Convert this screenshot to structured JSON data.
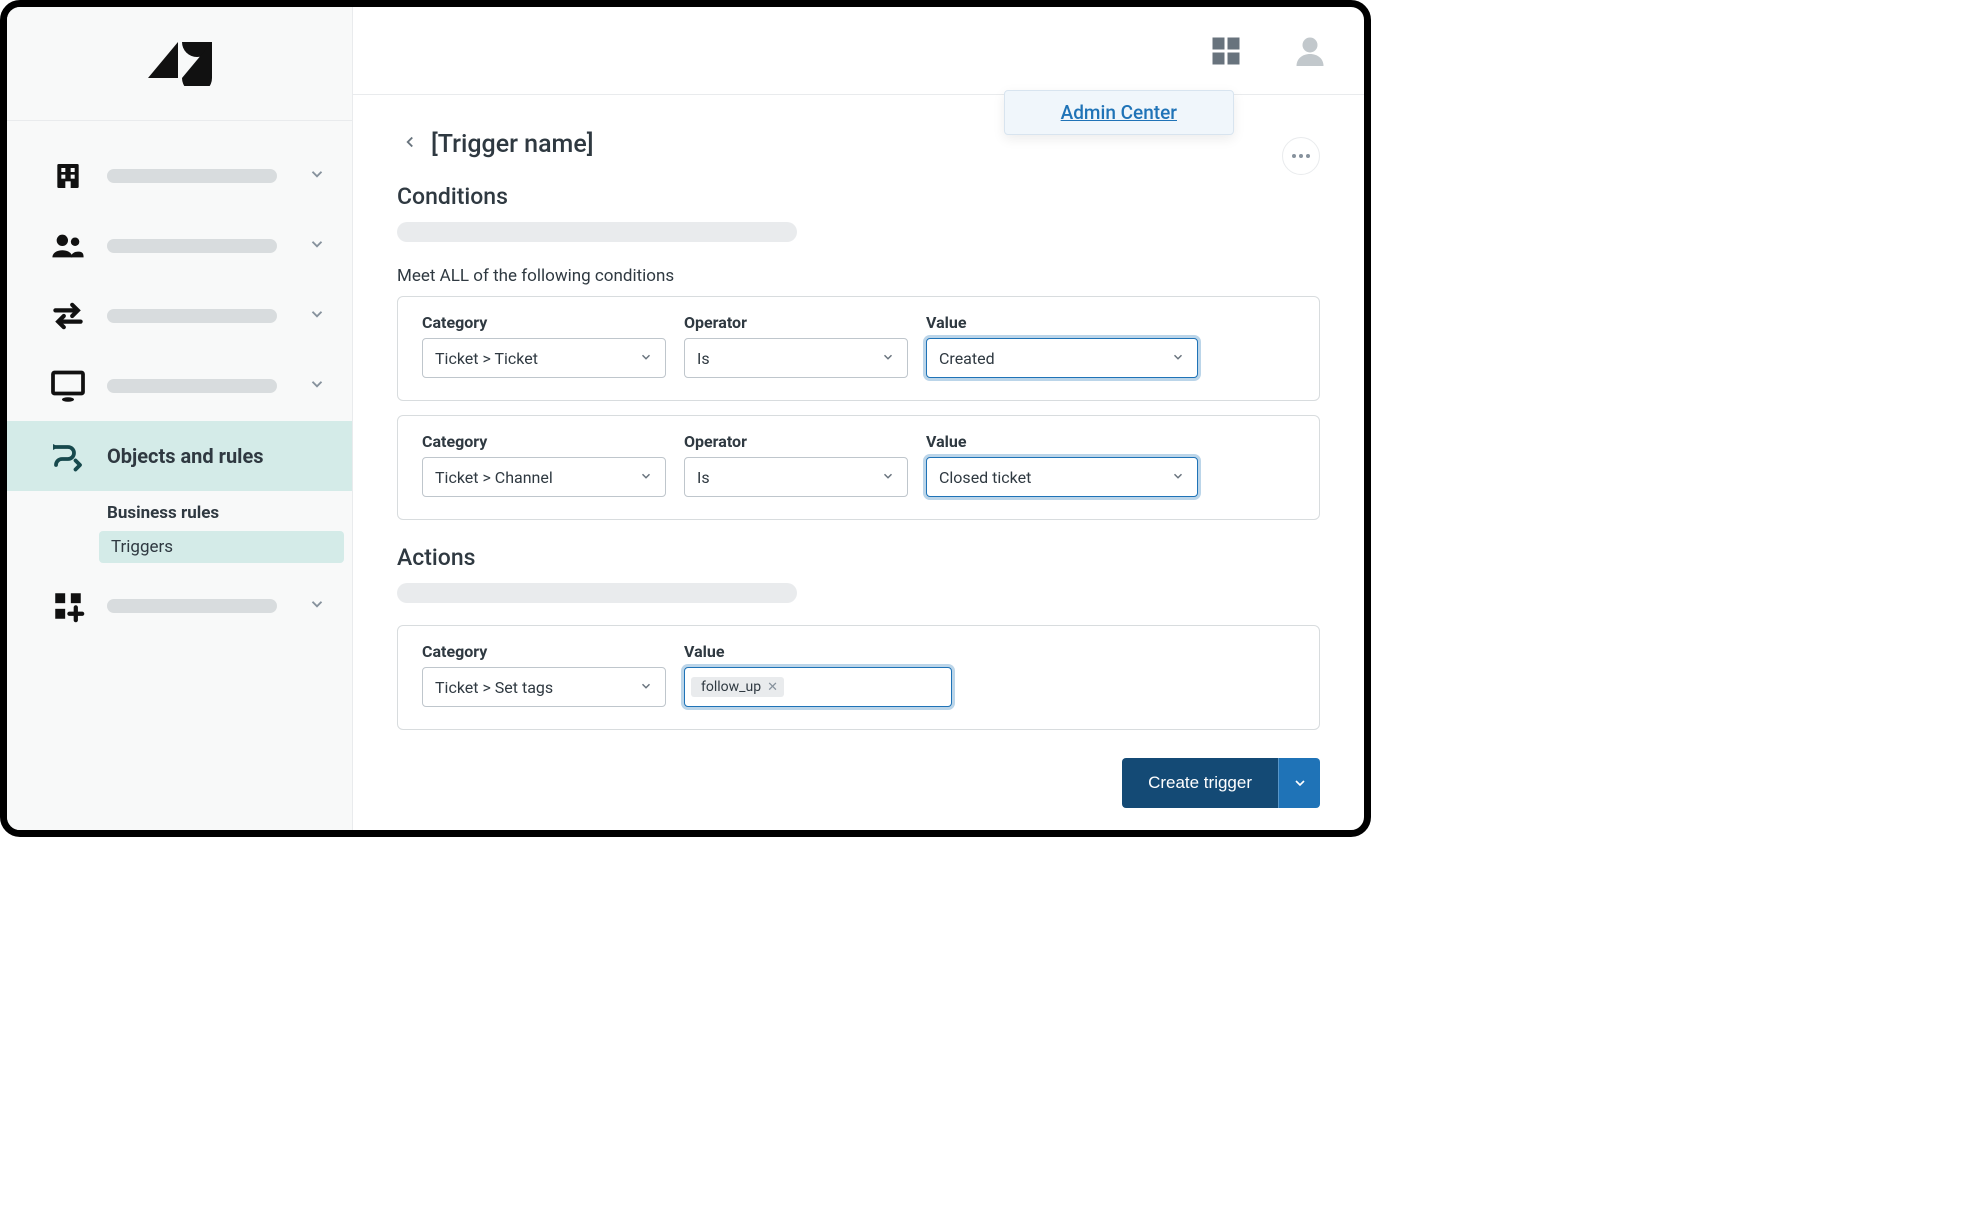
{
  "tooltip": {
    "label": "Admin Center"
  },
  "sidebar": {
    "active_label": "Objects and rules",
    "sub_heading": "Business rules",
    "sub_item": "Triggers"
  },
  "page": {
    "title": "[Trigger name]",
    "conditions_heading": "Conditions",
    "conditions_sub": "Meet ALL of the following conditions",
    "actions_heading": "Actions"
  },
  "labels": {
    "category": "Category",
    "operator": "Operator",
    "value": "Value"
  },
  "conditions": [
    {
      "category": "Ticket > Ticket",
      "operator": "Is",
      "value": "Created"
    },
    {
      "category": "Ticket > Channel",
      "operator": "Is",
      "value": "Closed ticket"
    }
  ],
  "action": {
    "category": "Ticket > Set tags",
    "tag": "follow_up"
  },
  "buttons": {
    "create": "Create trigger"
  }
}
